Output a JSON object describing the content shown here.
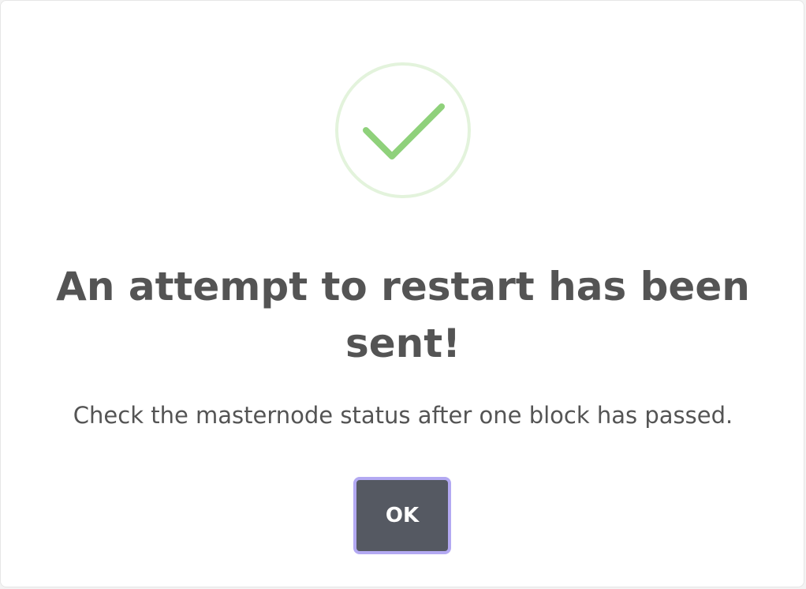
{
  "dialog": {
    "icon": "success-check-icon",
    "title": "An attempt to restart has been sent!",
    "message": "Check the masternode status after one block has passed.",
    "ok_label": "OK"
  },
  "colors": {
    "text": "#545454",
    "check": "#8fd17b",
    "check_ring": "#e3f3dc",
    "button_bg": "#555962",
    "button_focus": "#b3a9f2"
  }
}
